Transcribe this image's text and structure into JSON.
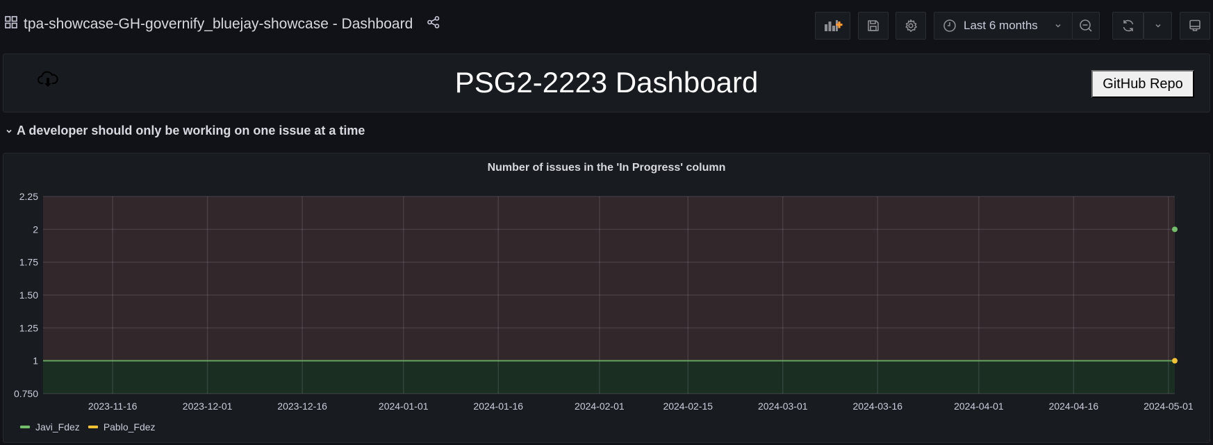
{
  "header": {
    "title": "tpa-showcase-GH-governify_bluejay-showcase - Dashboard",
    "icons": {
      "dashboard": "grid-icon",
      "share": "share-icon"
    },
    "toolbar": {
      "add_panel": "add-panel-icon",
      "save": "save-icon",
      "settings": "gear-icon",
      "time_range_label": "Last 6 months",
      "zoom_out": "zoom-out-icon",
      "refresh": "refresh-icon",
      "refresh_interval": "chevron-down-icon",
      "view_mode": "monitor-icon"
    }
  },
  "text_panel": {
    "title": "PSG2-2223 Dashboard",
    "button_label": "GitHub Repo",
    "icon": "cloud-download-icon"
  },
  "row": {
    "title": "A developer should only be working on one issue at a time"
  },
  "colors": {
    "javi": "#73bf69",
    "pablo": "#f2c232",
    "threshold_above": "#32272b",
    "threshold_below": "#1a2e22"
  },
  "chart_data": {
    "type": "line",
    "title": "Number of issues in the 'In Progress' column",
    "xlabel": "",
    "ylabel": "",
    "ylim": [
      0.75,
      2.25
    ],
    "y_ticks": [
      "2.25",
      "2",
      "1.75",
      "1.50",
      "1.25",
      "1",
      "0.750"
    ],
    "y_tick_values": [
      2.25,
      2,
      1.75,
      1.5,
      1.25,
      1,
      0.75
    ],
    "x_range": [
      "2023-11-05",
      "2024-05-02"
    ],
    "x_ticks": [
      "2023-11-16",
      "2023-12-01",
      "2023-12-16",
      "2024-01-01",
      "2024-01-16",
      "2024-02-01",
      "2024-02-15",
      "2024-03-01",
      "2024-03-16",
      "2024-04-01",
      "2024-04-16",
      "2024-05-01"
    ],
    "grid": true,
    "threshold": {
      "value": 1,
      "above_color": "#32272b",
      "below_color": "#1a2e22",
      "line_color": "#73bf69"
    },
    "legend_position": "bottom-left",
    "series": [
      {
        "name": "Javi_Fdez",
        "color": "#73bf69",
        "points": [
          {
            "x": "2024-05-02",
            "y": 2
          }
        ]
      },
      {
        "name": "Pablo_Fdez",
        "color": "#f2c232",
        "points": [
          {
            "x": "2024-05-02",
            "y": 1
          }
        ]
      }
    ]
  }
}
